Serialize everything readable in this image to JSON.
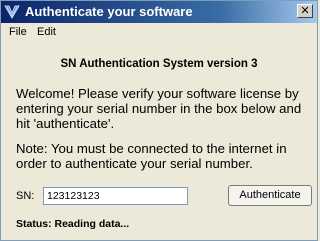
{
  "window": {
    "title": "Authenticate your software",
    "close_label": "✕"
  },
  "menu": {
    "items": [
      {
        "label": "File"
      },
      {
        "label": "Edit"
      }
    ]
  },
  "main": {
    "heading": "SN Authentication System version 3",
    "welcome_text": "Welcome! Please verify your software license by entering your serial number in the box below and hit 'authenticate'.",
    "note_text": "Note: You must be connected to the internet in order to authenticate your serial number.",
    "sn_label": "SN:",
    "sn_value": "123123123",
    "authenticate_label": "Authenticate",
    "status_text": "Status: Reading data..."
  },
  "colors": {
    "title_gradient_start": "#0a246a",
    "title_gradient_end": "#a6caf0",
    "window_bg": "#ece9d8"
  }
}
